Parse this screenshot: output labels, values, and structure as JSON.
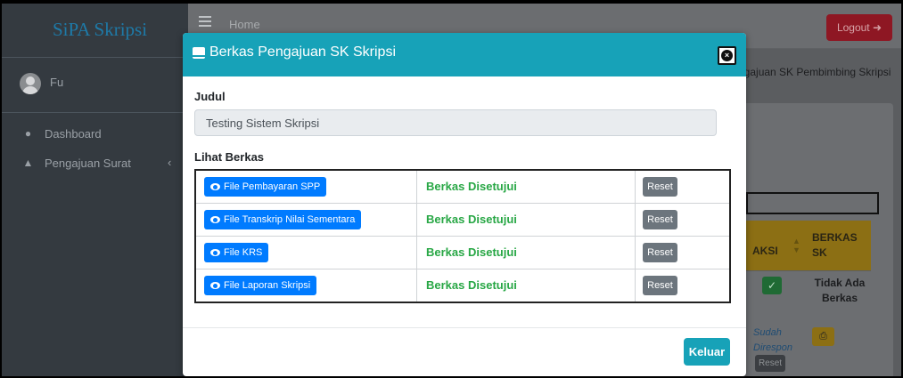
{
  "sidebar": {
    "brand": "SiPA Skripsi",
    "user_name": "Fu",
    "items": [
      {
        "label": "Dashboard",
        "icon": "tachometer-icon"
      },
      {
        "label": "Pengajuan Surat",
        "icon": "graduation-cap-icon"
      }
    ]
  },
  "topbar": {
    "home_label": "Home",
    "logout_label": "Logout"
  },
  "background": {
    "breadcrumb": "ngajuan SK Pembimbing Skripsi",
    "table_headers": {
      "aksi": "AKSI",
      "berkas_sk": "BERKAS SK"
    },
    "row1": {
      "berkas": "Tidak Ada Berkas"
    },
    "row2": {
      "status": "Sudah Direspon",
      "reset": "Reset"
    }
  },
  "modal": {
    "title": "Berkas Pengajuan SK Skripsi",
    "judul_label": "Judul",
    "judul_value": "Testing Sistem Skripsi",
    "lihat_label": "Lihat Berkas",
    "files": [
      {
        "button": "File Pembayaran SPP",
        "status": "Berkas Disetujui",
        "reset": "Reset"
      },
      {
        "button": "File Transkrip Nilai Sementara",
        "status": "Berkas Disetujui",
        "reset": "Reset"
      },
      {
        "button": "File KRS",
        "status": "Berkas Disetujui",
        "reset": "Reset"
      },
      {
        "button": "File Laporan Skripsi",
        "status": "Berkas Disetujui",
        "reset": "Reset"
      }
    ],
    "keluar_label": "Keluar"
  },
  "colors": {
    "modal_header": "#17a2b8",
    "file_button": "#007bff",
    "approved_text": "#28a745",
    "reset_button": "#6c757d",
    "logout_button": "#dc3545",
    "table_header": "#ffc107"
  }
}
